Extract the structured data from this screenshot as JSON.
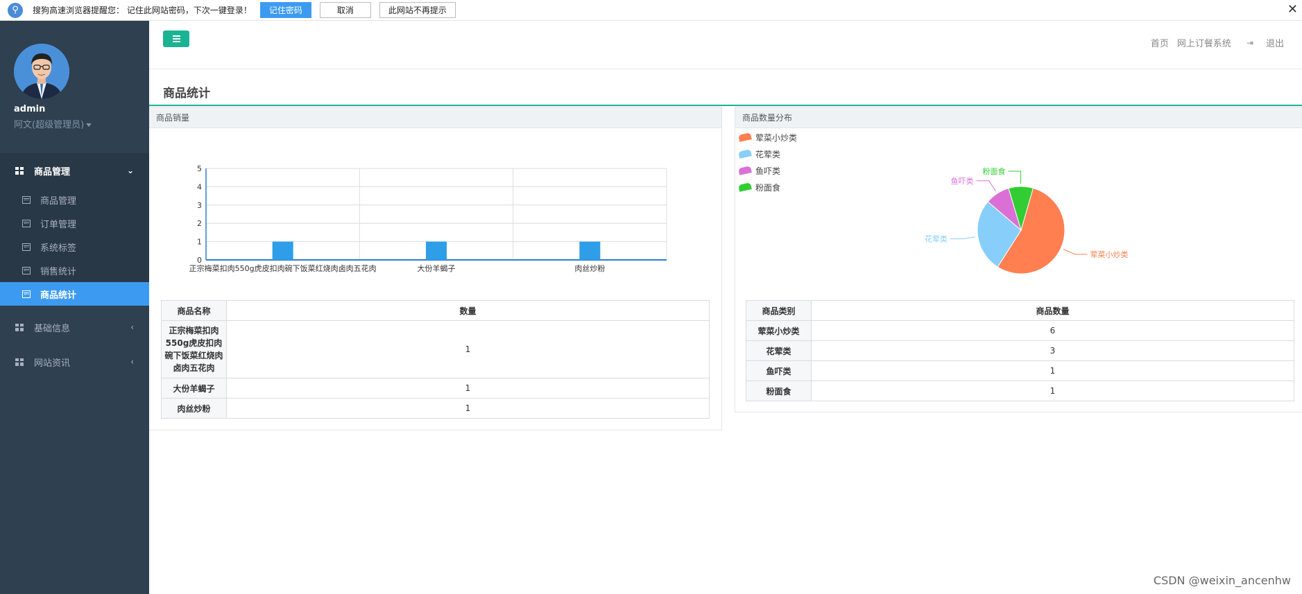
{
  "notice": {
    "message": "搜狗高速浏览器提醒您：  记住此网站密码，下次一键登录！",
    "remember_label": "记住密码",
    "cancel_label": "取消",
    "never_label": "此网站不再提示",
    "close_glyph": "✕"
  },
  "sidebar": {
    "username": "admin",
    "role": "阿文(超级管理员)",
    "groups": [
      {
        "label": "商品管理",
        "arrow": "⌄",
        "items": [
          {
            "label": "商品管理"
          },
          {
            "label": "订单管理"
          },
          {
            "label": "系统标签"
          },
          {
            "label": "销售统计"
          },
          {
            "label": "商品统计"
          }
        ]
      },
      {
        "label": "基础信息",
        "arrow": "‹"
      },
      {
        "label": "网站资讯",
        "arrow": "‹"
      }
    ]
  },
  "header": {
    "links": [
      "首页",
      "网上订餐系统"
    ],
    "exit_label": "退出",
    "exit_icon": "sign-out-icon"
  },
  "page": {
    "title": "商品统计"
  },
  "sales_panel": {
    "title": "商品销量",
    "table_headers": [
      "商品名称",
      "数量"
    ],
    "rows": [
      {
        "name": "正宗梅菜扣肉550g虎皮扣肉碗下饭菜红烧肉卤肉五花肉",
        "qty": "1"
      },
      {
        "name": "大份羊蝎子",
        "qty": "1"
      },
      {
        "name": "肉丝炒粉",
        "qty": "1"
      }
    ]
  },
  "dist_panel": {
    "title": "商品数量分布",
    "table_headers": [
      "商品类别",
      "商品数量"
    ],
    "rows": [
      {
        "name": "荤菜小炒类",
        "qty": "6"
      },
      {
        "name": "花荤类",
        "qty": "3"
      },
      {
        "name": "鱼吓类",
        "qty": "1"
      },
      {
        "name": "粉面食",
        "qty": "1"
      }
    ]
  },
  "chart_data": [
    {
      "type": "bar",
      "categories": [
        "正宗梅菜扣肉550g虎皮扣肉碗下饭菜红烧肉卤肉五花肉",
        "大份羊蝎子",
        "肉丝炒粉"
      ],
      "values": [
        1,
        1,
        1
      ],
      "ylim": [
        0,
        5
      ],
      "yticks": [
        "0",
        "1",
        "2",
        "3",
        "4",
        "5"
      ],
      "grid": true,
      "bar_color": "#2e9ee8"
    },
    {
      "type": "pie",
      "labels": [
        "荤菜小炒类",
        "花荤类",
        "鱼吓类",
        "粉面食"
      ],
      "values": [
        6,
        3,
        1,
        1
      ],
      "colors": [
        "#ff7f50",
        "#87cefa",
        "#da70d6",
        "#32cd32"
      ],
      "legend_position": "top-left"
    }
  ],
  "watermark": "CSDN @weixin_ancenhw"
}
